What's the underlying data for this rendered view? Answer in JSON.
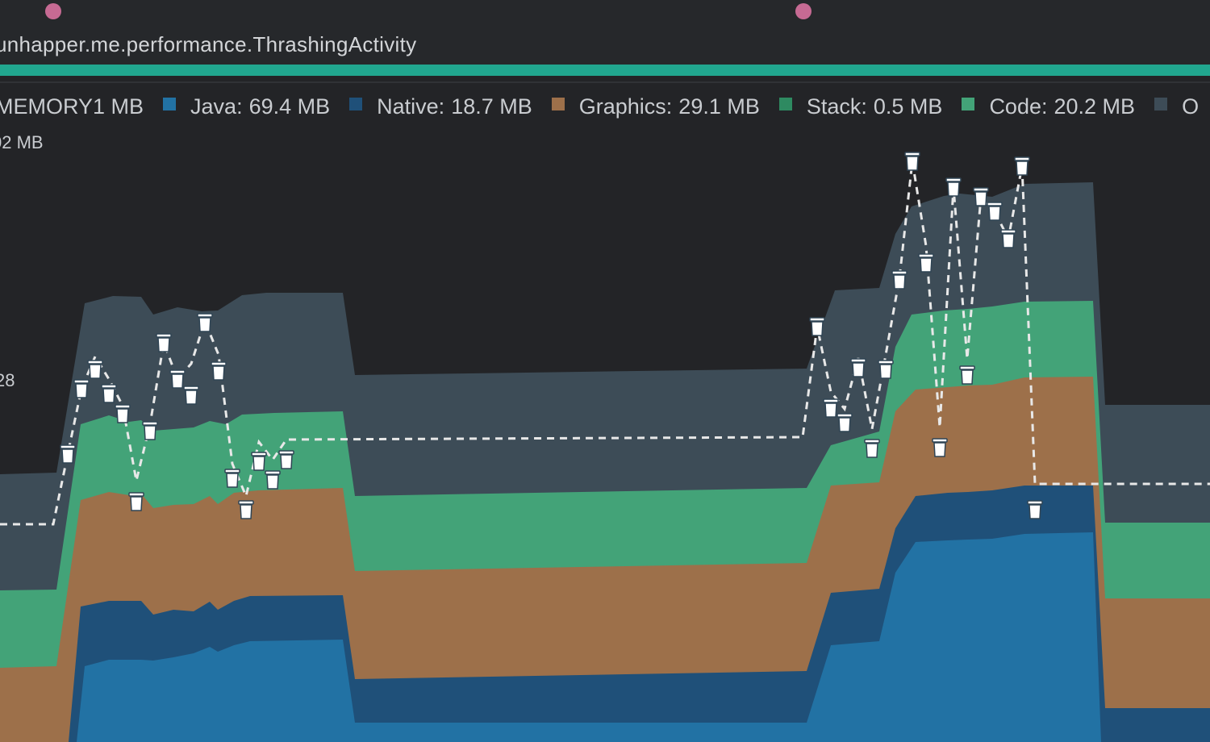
{
  "header": {
    "activity": "unhapper.me.performance.ThrashingActivity"
  },
  "legend": {
    "total": "MEMORY1 MB",
    "items": [
      {
        "label": "Java:",
        "value": "69.4 MB",
        "color": "#2272a4"
      },
      {
        "label": "Native:",
        "value": "18.7 MB",
        "color": "#1f5079"
      },
      {
        "label": "Graphics:",
        "value": "29.1 MB",
        "color": "#9d704a"
      },
      {
        "label": "Stack:",
        "value": "0.5 MB",
        "color": "#2e8a61"
      },
      {
        "label": "Code:",
        "value": "20.2 MB",
        "color": "#43a378"
      },
      {
        "label": "O",
        "value": "",
        "color": "#3d4c57"
      }
    ]
  },
  "axis": {
    "top_label": "02 MB",
    "mid_label": "28"
  },
  "colors": {
    "background": "#232427",
    "event_dot": "#c66a93",
    "session_bar": "#21a78f",
    "others": "#3d4c57",
    "code": "#43a378",
    "graphics": "#9d704a",
    "native": "#1f5079",
    "java": "#2272a4",
    "gc_icon": "#ffffff"
  },
  "icons": {
    "gc_event": "trash-can-icon",
    "session_event": "dot-icon"
  },
  "chart_data": {
    "type": "area",
    "title": "",
    "xlabel": "",
    "ylabel": "",
    "stacked": true,
    "series_order": [
      "Java",
      "Native",
      "Graphics",
      "Code",
      "Others"
    ],
    "series": [
      {
        "name": "Java",
        "color": "#2272a4"
      },
      {
        "name": "Native",
        "color": "#1f5079"
      },
      {
        "name": "Graphics",
        "color": "#9d704a"
      },
      {
        "name": "Code",
        "color": "#43a378"
      },
      {
        "name": "Others",
        "color": "#3d4c57"
      }
    ],
    "gc_events_count": 33,
    "allocation_tracking_line": "dashed"
  }
}
